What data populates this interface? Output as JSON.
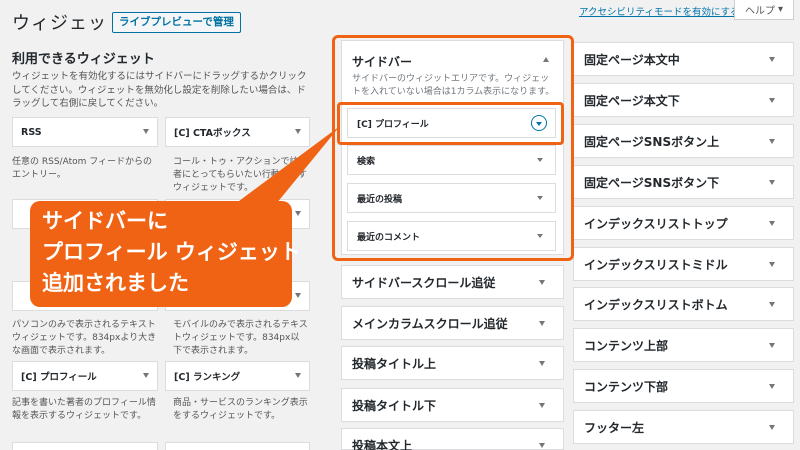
{
  "header": {
    "title": "ウィジェット",
    "manage_button": "ライブプレビューで管理",
    "accessibility_link": "アクセシビリティモードを有効にする",
    "help_tab": "ヘルプ"
  },
  "available": {
    "title": "利用できるウィジェット",
    "description": "ウィジェットを有効化するにはサイドバーにドラッグするかクリックしてください。ウィジェットを無効化し設定を削除したい場合は、ドラッグして右側に戻してください。",
    "widgets": [
      {
        "label": "RSS",
        "desc": "任意の RSS/Atom フィードからのエントリー。"
      },
      {
        "label": "[C] CTAボックス",
        "desc": "コール・トゥ・アクションで訪問者にとってもらいたい行動を示すウィジェットです。"
      },
      {
        "label": "",
        "desc": "パソコンのみで表示されるテキストウィジェットです。834pxより大きな画面で表示されます。"
      },
      {
        "label": "",
        "desc": "モバイルのみで表示されるテキストウィジェットです。834px以下で表示されます。"
      },
      {
        "label": "[C] プロフィール",
        "desc": "記事を書いた著者のプロフィール情報を表示するウィジェットです。"
      },
      {
        "label": "[C] ランキング",
        "desc": "商品・サービスのランキング表示をするウィジェットです。"
      }
    ]
  },
  "sidebar": {
    "title": "サイドバー",
    "description": "サイドバーのウィジットエリアです。ウィジェットを入れていない場合は1カラム表示になります。",
    "widgets": [
      {
        "label": "[C] プロフィール"
      },
      {
        "label": "検索"
      },
      {
        "label": "最近の投稿"
      },
      {
        "label": "最近のコメント"
      }
    ]
  },
  "middle_areas": [
    {
      "label": "サイドバースクロール追従"
    },
    {
      "label": "メインカラムスクロール追従"
    },
    {
      "label": "投稿タイトル上"
    },
    {
      "label": "投稿タイトル下"
    },
    {
      "label": "投稿本文上"
    }
  ],
  "right_areas": [
    {
      "label": "固定ページ本文中"
    },
    {
      "label": "固定ページ本文下"
    },
    {
      "label": "固定ページSNSボタン上"
    },
    {
      "label": "固定ページSNSボタン下"
    },
    {
      "label": "インデックスリストトップ"
    },
    {
      "label": "インデックスリストミドル"
    },
    {
      "label": "インデックスリストボトム"
    },
    {
      "label": "コンテンツ上部"
    },
    {
      "label": "コンテンツ下部"
    },
    {
      "label": "フッター左"
    }
  ],
  "callout": {
    "line1": "サイドバーに",
    "line2": "プロフィール ウィジェット",
    "line3": "追加されました"
  },
  "colors": {
    "highlight": "#f06214",
    "link": "#0073aa"
  }
}
